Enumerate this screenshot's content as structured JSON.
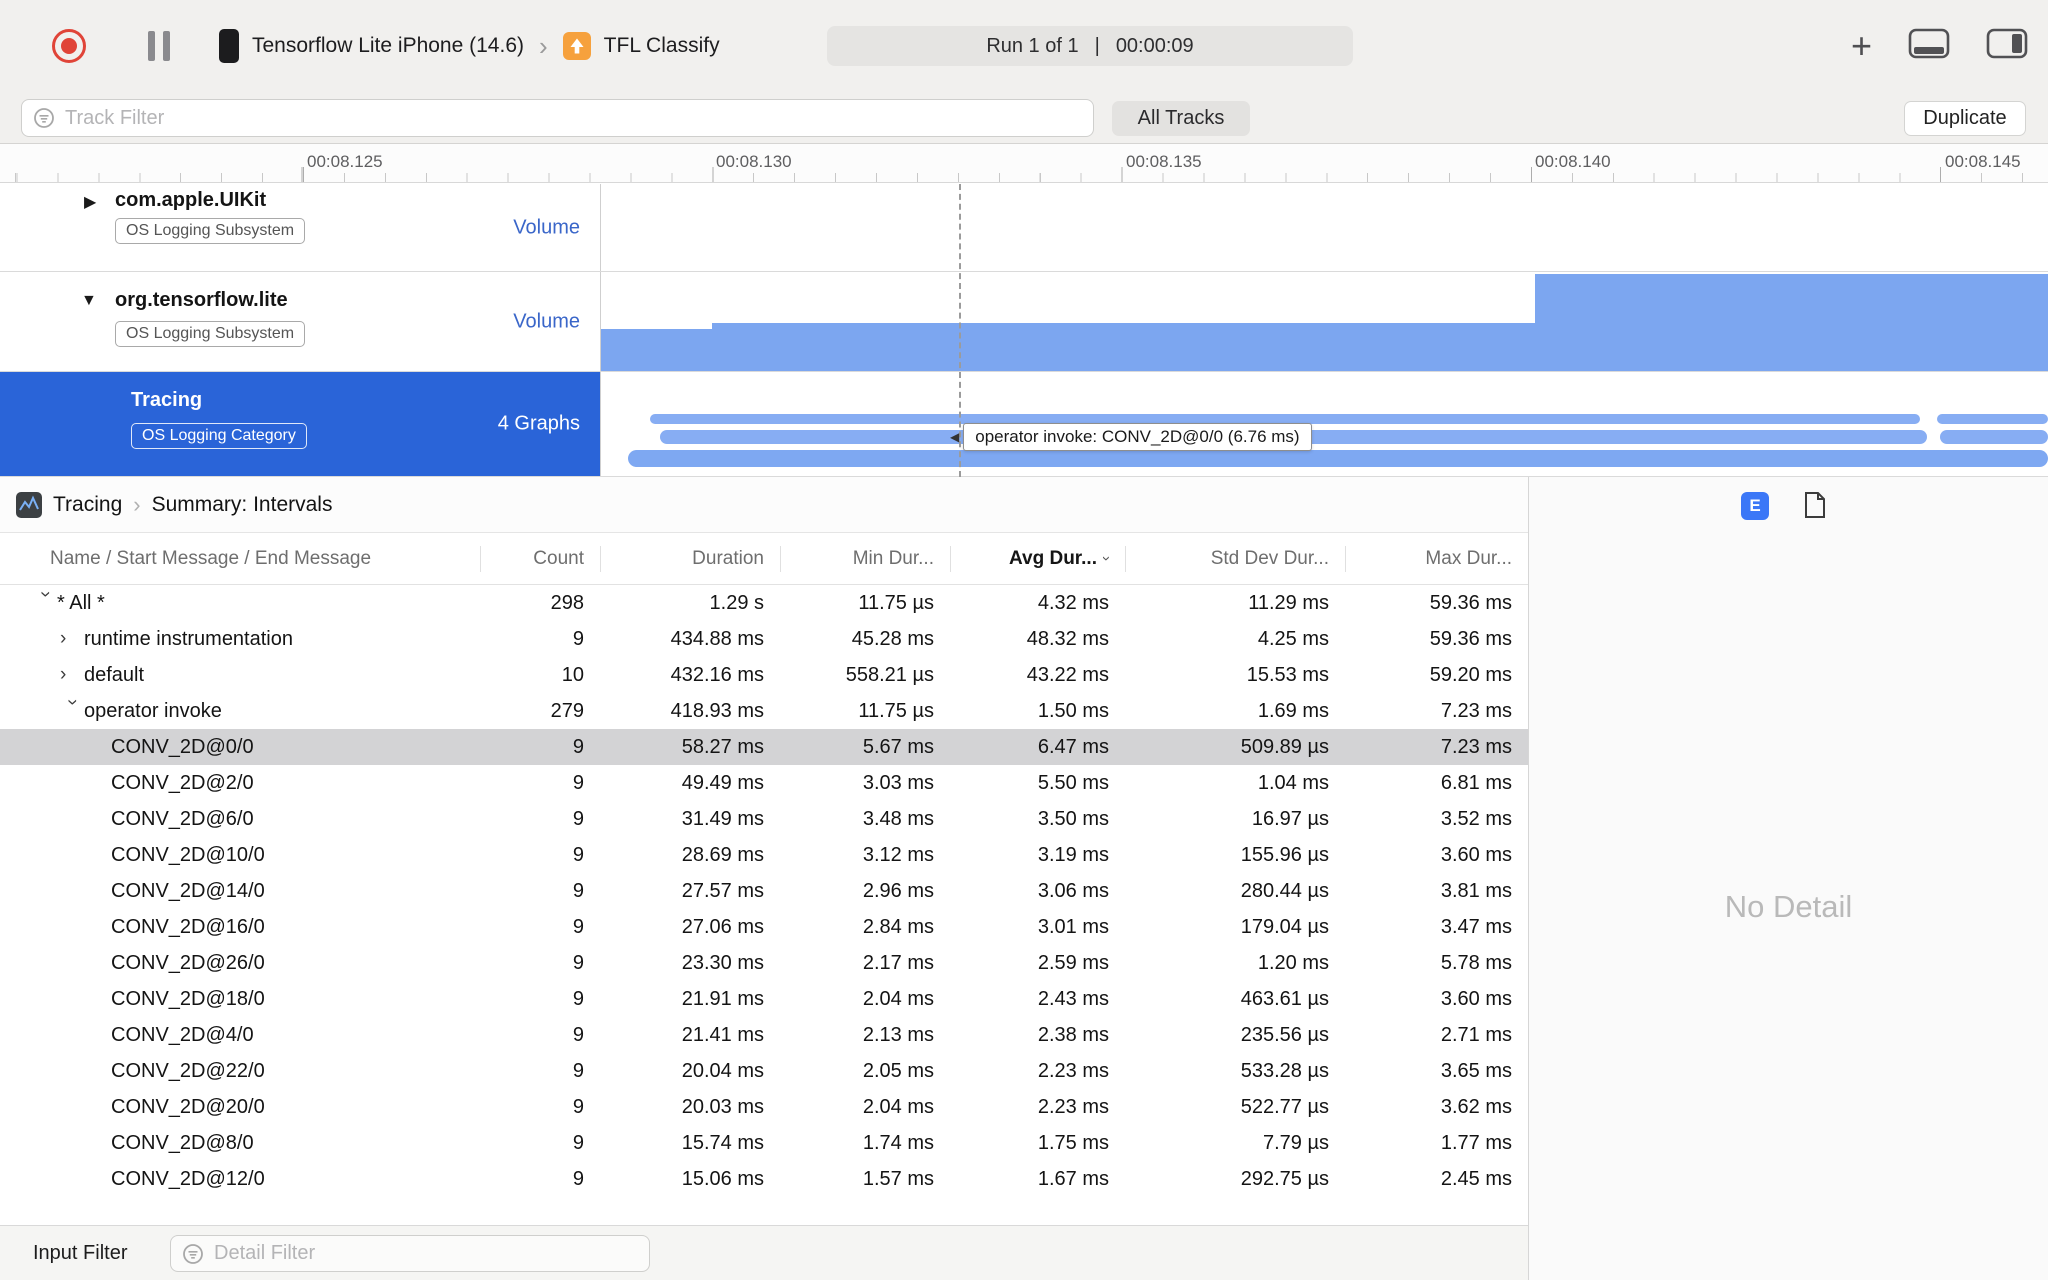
{
  "toolbar": {
    "device_name": "Tensorflow Lite iPhone (14.6)",
    "target_app": "TFL Classify",
    "run_label": "Run 1 of 1",
    "separator": "|",
    "elapsed": "00:00:09"
  },
  "filter_bar": {
    "track_filter_placeholder": "Track Filter",
    "all_tracks": "All Tracks",
    "duplicate": "Duplicate"
  },
  "ruler": {
    "labels": [
      "00:08.125",
      "00:08.130",
      "00:08.135",
      "00:08.140",
      "00:08.145"
    ]
  },
  "tracks": [
    {
      "name": "com.apple.UIKit",
      "badge": "OS Logging Subsystem",
      "meta": "Volume"
    },
    {
      "name": "org.tensorflow.lite",
      "badge": "OS Logging Subsystem",
      "meta": "Volume"
    },
    {
      "name": "Tracing",
      "badge": "OS Logging Category",
      "meta": "4 Graphs"
    }
  ],
  "tooltip": {
    "text": "operator invoke: CONV_2D@0/0 (6.76 ms)"
  },
  "detail": {
    "breadcrumb_root": "Tracing",
    "breadcrumb_page": "Summary: Intervals",
    "inspector_flag": "E",
    "no_detail": "No Detail",
    "columns": [
      "Name / Start Message / End Message",
      "Count",
      "Duration",
      "Min Dur...",
      "Avg Dur...",
      "Std Dev Dur...",
      "Max Dur..."
    ],
    "sort_column": "Avg Dur...",
    "rows": [
      {
        "indent": 0,
        "chevron": "expanded",
        "name": "* All *",
        "count": "298",
        "duration": "1.29 s",
        "min": "11.75 µs",
        "avg": "4.32 ms",
        "std": "11.29 ms",
        "max": "59.36 ms"
      },
      {
        "indent": 1,
        "chevron": "collapsed",
        "name": "runtime instrumentation",
        "count": "9",
        "duration": "434.88 ms",
        "min": "45.28 ms",
        "avg": "48.32 ms",
        "std": "4.25 ms",
        "max": "59.36 ms"
      },
      {
        "indent": 1,
        "chevron": "collapsed",
        "name": "default",
        "count": "10",
        "duration": "432.16 ms",
        "min": "558.21 µs",
        "avg": "43.22 ms",
        "std": "15.53 ms",
        "max": "59.20 ms"
      },
      {
        "indent": 1,
        "chevron": "expanded",
        "name": "operator invoke",
        "count": "279",
        "duration": "418.93 ms",
        "min": "11.75 µs",
        "avg": "1.50 ms",
        "std": "1.69 ms",
        "max": "7.23 ms"
      },
      {
        "indent": 2,
        "selected": true,
        "name": "CONV_2D@0/0",
        "count": "9",
        "duration": "58.27 ms",
        "min": "5.67 ms",
        "avg": "6.47 ms",
        "std": "509.89 µs",
        "max": "7.23 ms"
      },
      {
        "indent": 2,
        "name": "CONV_2D@2/0",
        "count": "9",
        "duration": "49.49 ms",
        "min": "3.03 ms",
        "avg": "5.50 ms",
        "std": "1.04 ms",
        "max": "6.81 ms"
      },
      {
        "indent": 2,
        "name": "CONV_2D@6/0",
        "count": "9",
        "duration": "31.49 ms",
        "min": "3.48 ms",
        "avg": "3.50 ms",
        "std": "16.97 µs",
        "max": "3.52 ms"
      },
      {
        "indent": 2,
        "name": "CONV_2D@10/0",
        "count": "9",
        "duration": "28.69 ms",
        "min": "3.12 ms",
        "avg": "3.19 ms",
        "std": "155.96 µs",
        "max": "3.60 ms"
      },
      {
        "indent": 2,
        "name": "CONV_2D@14/0",
        "count": "9",
        "duration": "27.57 ms",
        "min": "2.96 ms",
        "avg": "3.06 ms",
        "std": "280.44 µs",
        "max": "3.81 ms"
      },
      {
        "indent": 2,
        "name": "CONV_2D@16/0",
        "count": "9",
        "duration": "27.06 ms",
        "min": "2.84 ms",
        "avg": "3.01 ms",
        "std": "179.04 µs",
        "max": "3.47 ms"
      },
      {
        "indent": 2,
        "name": "CONV_2D@26/0",
        "count": "9",
        "duration": "23.30 ms",
        "min": "2.17 ms",
        "avg": "2.59 ms",
        "std": "1.20 ms",
        "max": "5.78 ms"
      },
      {
        "indent": 2,
        "name": "CONV_2D@18/0",
        "count": "9",
        "duration": "21.91 ms",
        "min": "2.04 ms",
        "avg": "2.43 ms",
        "std": "463.61 µs",
        "max": "3.60 ms"
      },
      {
        "indent": 2,
        "name": "CONV_2D@4/0",
        "count": "9",
        "duration": "21.41 ms",
        "min": "2.13 ms",
        "avg": "2.38 ms",
        "std": "235.56 µs",
        "max": "2.71 ms"
      },
      {
        "indent": 2,
        "name": "CONV_2D@22/0",
        "count": "9",
        "duration": "20.04 ms",
        "min": "2.05 ms",
        "avg": "2.23 ms",
        "std": "533.28 µs",
        "max": "3.65 ms"
      },
      {
        "indent": 2,
        "name": "CONV_2D@20/0",
        "count": "9",
        "duration": "20.03 ms",
        "min": "2.04 ms",
        "avg": "2.23 ms",
        "std": "522.77 µs",
        "max": "3.62 ms"
      },
      {
        "indent": 2,
        "name": "CONV_2D@8/0",
        "count": "9",
        "duration": "15.74 ms",
        "min": "1.74 ms",
        "avg": "1.75 ms",
        "std": "7.79 µs",
        "max": "1.77 ms"
      },
      {
        "indent": 2,
        "name": "CONV_2D@12/0",
        "count": "9",
        "duration": "15.06 ms",
        "min": "1.57 ms",
        "avg": "1.67 ms",
        "std": "292.75 µs",
        "max": "2.45 ms"
      }
    ]
  },
  "bottom_bar": {
    "input_filter_label": "Input Filter",
    "detail_filter_placeholder": "Detail Filter"
  },
  "icons": {
    "chevron": "›",
    "disclosure_collapsed": "▶",
    "disclosure_expanded": "▼",
    "tooltip_arrow": "◀",
    "plus": "+"
  },
  "colors": {
    "selection_blue": "#2A64D8",
    "volume_bar_blue": "#7CA6F0",
    "interval_capsule_blue": "#87ADF3",
    "selected_row_gray": "#D3D3D5",
    "record_red": "#E04438",
    "flag_button_blue": "#3B77F7"
  }
}
